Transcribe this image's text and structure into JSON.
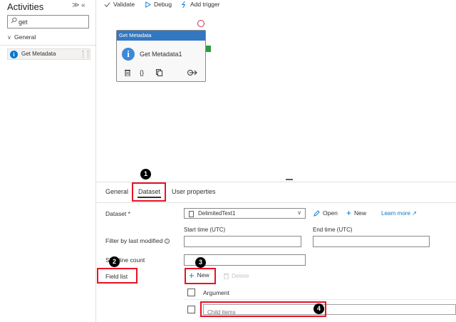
{
  "activities": {
    "title": "Activities",
    "collapse_glyph": "≫",
    "hide_glyph": "«",
    "search_value": "get",
    "section_label": "General",
    "item_label": "Get Metadata"
  },
  "toolbar": {
    "validate_label": "Validate",
    "debug_label": "Debug",
    "add_trigger_label": "Add trigger"
  },
  "node": {
    "header": "Get Metadata",
    "name": "Get Metadata1",
    "header_color": "#3277c1"
  },
  "tabs": [
    {
      "label": "General"
    },
    {
      "label": "Dataset"
    },
    {
      "label": "User properties"
    }
  ],
  "dataset": {
    "label": "Dataset *",
    "value": "DelimitedText1",
    "open_label": "Open",
    "new_label": "New",
    "learn_more_label": "Learn more"
  },
  "filter": {
    "label": "Filter by last modified",
    "start_label": "Start time (UTC)",
    "end_label": "End time (UTC)"
  },
  "skip": {
    "label": "Skip line count"
  },
  "field_list": {
    "label": "Field list",
    "new_label": "New",
    "delete_label": "Delete",
    "header_label": "Argument",
    "row_placeholder": "Child items"
  },
  "steps": [
    "1",
    "2",
    "3",
    "4"
  ],
  "colors": {
    "accent": "#0078d4",
    "highlight": "#e81123",
    "port": "#2b9d3a"
  }
}
